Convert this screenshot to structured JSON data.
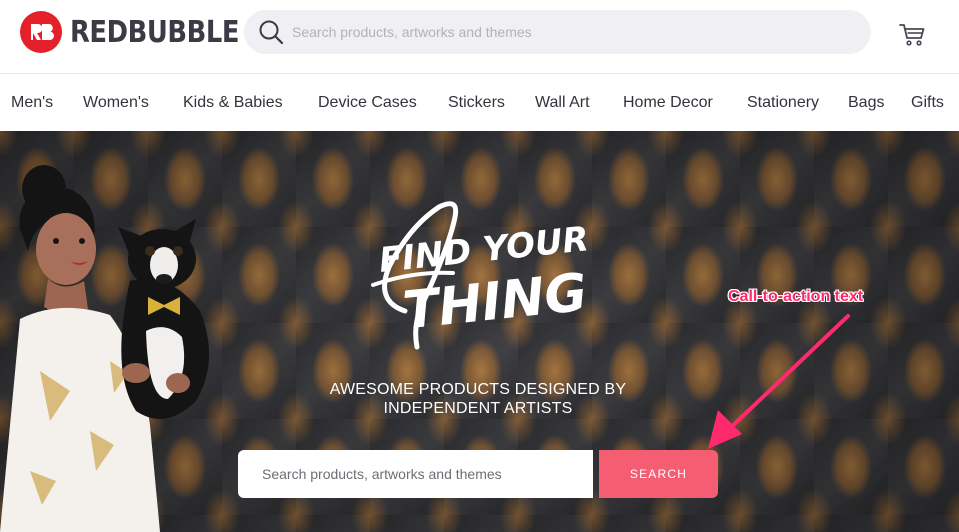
{
  "brand": {
    "name": "REDBUBBLE",
    "color": "#e4202a"
  },
  "header": {
    "search_placeholder": "Search products, artworks and themes",
    "cart_icon": "cart-icon"
  },
  "nav": {
    "items": [
      "Men's",
      "Women's",
      "Kids & Babies",
      "Device Cases",
      "Stickers",
      "Wall Art",
      "Home Decor",
      "Stationery",
      "Bags",
      "Gifts"
    ]
  },
  "hero": {
    "headline_line1": "FIND YOUR",
    "headline_line2": "THING",
    "subhead_line1": "AWESOME PRODUCTS DESIGNED BY",
    "subhead_line2": "INDEPENDENT ARTISTS",
    "search_placeholder": "Search products, artworks and themes",
    "search_button": "SEARCH",
    "button_color": "#f55d73"
  },
  "annotation": {
    "label": "Call-to-action text",
    "color": "#ff2a6d"
  }
}
